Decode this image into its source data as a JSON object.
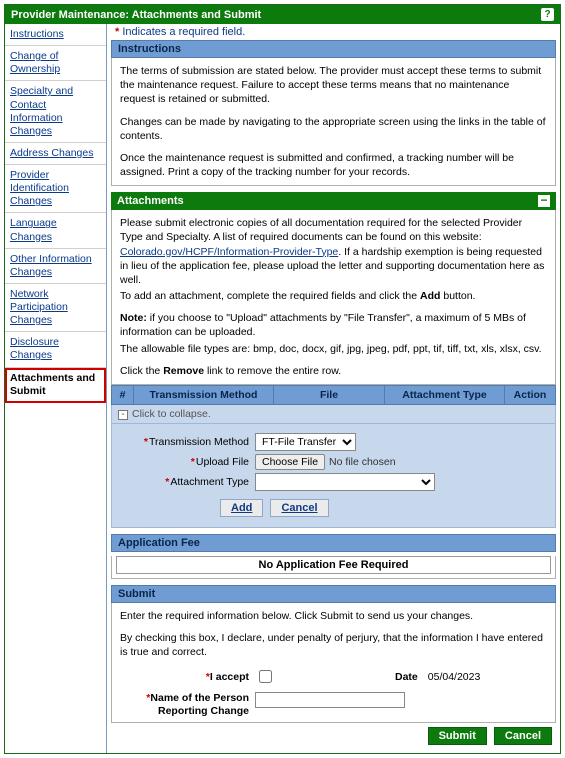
{
  "title": "Provider Maintenance: Attachments and Submit",
  "required_note": "Indicates a required field.",
  "sidebar": {
    "items": [
      {
        "label": "Instructions"
      },
      {
        "label": "Change of Ownership"
      },
      {
        "label": "Specialty and Contact Information Changes"
      },
      {
        "label": "Address Changes"
      },
      {
        "label": "Provider Identification Changes"
      },
      {
        "label": "Language Changes"
      },
      {
        "label": "Other Information Changes"
      },
      {
        "label": "Network Participation Changes"
      },
      {
        "label": "Disclosure Changes"
      },
      {
        "label": "Attachments and Submit"
      }
    ],
    "active_index": 9
  },
  "instructions": {
    "heading": "Instructions",
    "p1": "The terms of submission are stated below. The provider must accept these terms to submit the maintenance request. Failure to accept these terms means that no maintenance request is retained or submitted.",
    "p2": "Changes can be made by navigating to the appropriate screen using the links in the table of contents.",
    "p3": "Once the maintenance request is submitted and confirmed, a tracking number will be assigned. Print a copy of the tracking number for your records."
  },
  "attachments": {
    "heading": "Attachments",
    "p1a": "Please submit electronic copies of all documentation required for the selected Provider Type and Specialty. A list of required documents can be found on this website: ",
    "link_text": "Colorado.gov/HCPF/Information-Provider-Type",
    "p1b": ". If a hardship exemption is being requested in lieu of the application fee, please upload the letter and supporting documentation here as well.",
    "p2a": "To add an attachment, complete the required fields and click the ",
    "p2_bold": "Add",
    "p2b": " button.",
    "note_label": "Note:",
    "note_text": " if you choose to \"Upload\" attachments by \"File Transfer\", a maximum of 5 MBs of information can be uploaded.",
    "filetypes": "The allowable file types are: bmp, doc, docx, gif, jpg, jpeg, pdf, ppt, tif, tiff, txt, xls, xlsx, csv.",
    "remove_a": "Click the ",
    "remove_bold": "Remove",
    "remove_b": " link to remove the entire row.",
    "grid": {
      "col_num": "#",
      "col_tm": "Transmission Method",
      "col_file": "File",
      "col_at": "Attachment Type",
      "col_act": "Action"
    },
    "collapse_text": "Click to collapse.",
    "form": {
      "tm_label": "Transmission Method",
      "tm_value": "FT-File Transfer",
      "upload_label": "Upload File",
      "choose_btn": "Choose File",
      "no_file": "No file chosen",
      "at_label": "Attachment Type",
      "add_btn": "Add",
      "cancel_btn": "Cancel"
    }
  },
  "app_fee": {
    "heading": "Application Fee",
    "msg": "No Application Fee Required"
  },
  "submit": {
    "heading": "Submit",
    "p1": "Enter the required information below. Click Submit to send us your changes.",
    "p2": "By checking this box, I declare, under penalty of perjury, that the information I have entered is true and correct.",
    "accept_label": "I accept",
    "date_label": "Date",
    "date_value": "05/04/2023",
    "name_label": "Name of the Person Reporting Change",
    "submit_btn": "Submit",
    "cancel_btn": "Cancel"
  }
}
